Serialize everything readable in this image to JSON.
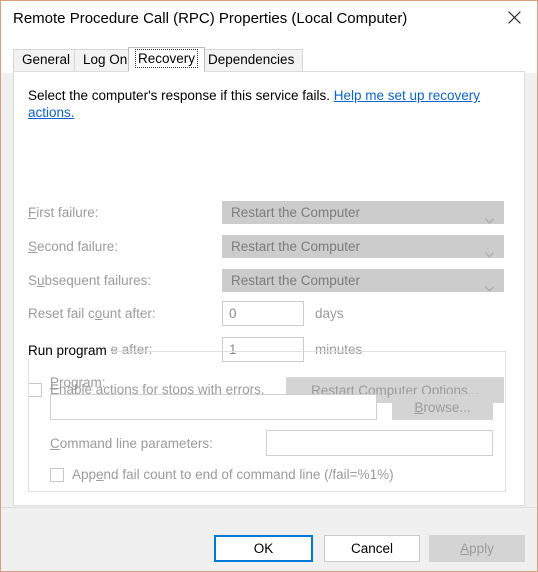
{
  "window": {
    "title": "Remote Procedure Call (RPC) Properties (Local Computer)",
    "close_icon": "close-icon",
    "border_color": "#d9a07c"
  },
  "tabs": [
    {
      "label": "General",
      "selected": false
    },
    {
      "label": "Log On",
      "selected": false
    },
    {
      "label": "Recovery",
      "selected": true
    },
    {
      "label": "Dependencies",
      "selected": false
    }
  ],
  "recovery": {
    "description": "Select the computer's response if this service fails.",
    "help_link": "Help me set up recovery actions.",
    "link_color": "#0b63ce",
    "rows": [
      {
        "label_pre": "F",
        "label_mnemonic": "F",
        "label": "First failure:",
        "label_before": "",
        "label_after": "irst failure:",
        "value": "Restart the Computer",
        "control": "combobox",
        "disabled": true
      },
      {
        "label": "Second failure:",
        "label_before": "",
        "label_mnemonic": "S",
        "label_after": "econd failure:",
        "value": "Restart the Computer",
        "control": "combobox",
        "disabled": true
      },
      {
        "label": "Subsequent failures:",
        "label_before": "S",
        "label_mnemonic": "u",
        "label_after": "bsequent failures:",
        "value": "Restart the Computer",
        "control": "combobox",
        "disabled": true
      }
    ],
    "reset_fail_count": {
      "label_before": "Reset fail c",
      "label_mnemonic": "o",
      "label_after": "unt after:",
      "value": "0",
      "unit": "days"
    },
    "restart_service": {
      "label_before": "Restart ser",
      "label_mnemonic": "v",
      "label_after": "ice after:",
      "value": "1",
      "unit": "minutes"
    },
    "enable_actions": {
      "label": "Enable actions for stops with errors.",
      "checked": false
    },
    "restart_computer_options": {
      "label_before": "",
      "label_mnemonic": "R",
      "label_after": "estart Computer Options...",
      "disabled": true
    },
    "run_program": {
      "legend": "Run program",
      "program": {
        "label_before": "",
        "label_mnemonic": "P",
        "label_after": "rogram:",
        "value": "",
        "placeholder": ""
      },
      "browse": {
        "label_before": "",
        "label_mnemonic": "B",
        "label_after": "rowse...",
        "disabled": true
      },
      "command_line": {
        "label_before": "",
        "label_mnemonic": "C",
        "label_after": "ommand line parameters:",
        "value": "",
        "placeholder": ""
      },
      "append_fail_count": {
        "label_before": "App",
        "label_mnemonic": "e",
        "label_after": "nd fail count to end of command line (/fail=%1%)",
        "checked": false
      }
    }
  },
  "footer": {
    "ok": "OK",
    "cancel": "Cancel",
    "apply_before": "",
    "apply_mnemonic": "A",
    "apply_after": "pply",
    "apply_disabled": true,
    "focus_color": "#0078d7"
  }
}
